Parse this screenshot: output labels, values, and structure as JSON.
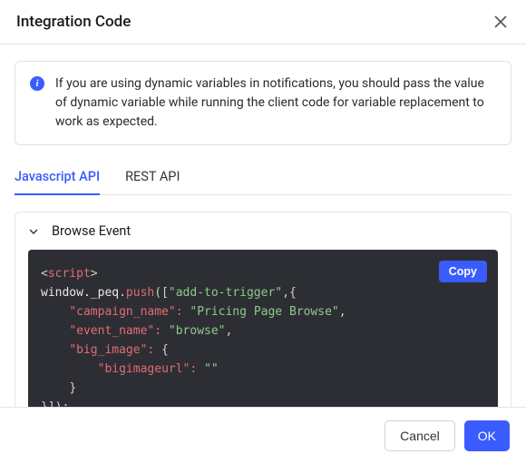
{
  "header": {
    "title": "Integration Code"
  },
  "info": {
    "text": "If you are using dynamic variables in notifications, you should pass the value of dynamic variable while running the client code for variable replacement to work as expected."
  },
  "tabs": [
    {
      "label": "Javascript API",
      "active": true
    },
    {
      "label": "REST API",
      "active": false
    }
  ],
  "section": {
    "title": "Browse Event",
    "expanded": true,
    "copy_label": "Copy",
    "code": {
      "tag_open": "<",
      "tag_name": "script",
      "tag_close": ">",
      "object": "window._peq",
      "dot": ".",
      "method": "push",
      "open_call": "([",
      "event_string": "\"add-to-trigger\"",
      "comma_brace": ",{",
      "campaign_key": "\"campaign_name\":",
      "campaign_val": " \"Pricing Page Browse\"",
      "comma1": ",",
      "event_key": "\"event_name\":",
      "event_val": " \"browse\"",
      "comma2": ",",
      "bigimage_key": "\"big_image\":",
      "open_inner": " {",
      "bigurl_key": "\"bigimageurl\":",
      "bigurl_val": " \"\"",
      "close_inner": "}",
      "close_call": "}]);"
    }
  },
  "footer": {
    "cancel": "Cancel",
    "ok": "OK"
  }
}
